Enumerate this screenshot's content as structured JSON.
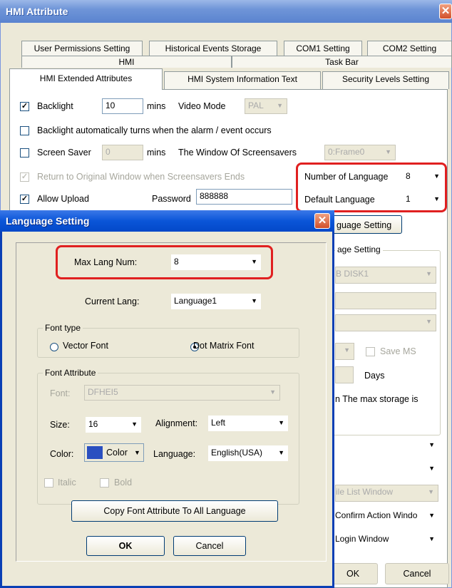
{
  "window": {
    "title": "HMI Attribute",
    "close": "✕"
  },
  "tabs_row1": [
    "User Permissions Setting",
    "Historical Events Storage",
    "COM1 Setting",
    "COM2 Setting"
  ],
  "tabs_row2": [
    "HMI",
    "Task Bar"
  ],
  "tabs_row3": [
    "HMI Extended Attributes",
    "HMI System Information Text",
    "Security Levels Setting"
  ],
  "main": {
    "backlight_label": "Backlight",
    "backlight_value": "10",
    "mins": "mins",
    "video_mode_label": "Video Mode",
    "video_mode_value": "PAL",
    "backlight_alarm_label": "Backlight automatically turns when the alarm / event occurs",
    "screen_saver_label": "Screen Saver",
    "screen_saver_value": "0",
    "mins2": "mins",
    "window_of_screensavers_label": "The Window Of Screensavers",
    "screensaver_window_value": "0:Frame0",
    "return_label": "Return to Original Window when Screensavers Ends",
    "num_language_label": "Number of Language",
    "num_language_value": "8",
    "allow_upload_label": "Allow Upload",
    "password_label": "Password",
    "password_value": "888888",
    "default_language_label": "Default Language",
    "default_language_value": "1",
    "language_setting_button": "guage Setting",
    "storage_group_title": "age Setting",
    "storage_device": "B DISK1",
    "save_ms_label": "Save MS",
    "days_label": "Days",
    "max_storage_text": "n The max storage is",
    "file_list_window": "ile List Window",
    "confirm_action_window": "Confirm Action Windo",
    "login_window": "Login Window",
    "ok": "OK",
    "cancel": "Cancel"
  },
  "dialog": {
    "title": "Language Setting",
    "close": "✕",
    "max_lang_label": "Max Lang Num:",
    "max_lang_value": "8",
    "current_lang_label": "Current Lang:",
    "current_lang_value": "Language1",
    "font_type_title": "Font type",
    "vector_font": "Vector Font",
    "dot_matrix_font": "Dot Matrix Font",
    "font_attribute_title": "Font Attribute",
    "font_label": "Font:",
    "font_value": "DFHEI5",
    "size_label": "Size:",
    "size_value": "16",
    "alignment_label": "Alignment:",
    "alignment_value": "Left",
    "color_label": "Color:",
    "color_button": "Color",
    "color_swatch": "#2a4fc0",
    "language_label": "Language:",
    "language_value": "English(USA)",
    "italic_label": "Italic",
    "bold_label": "Bold",
    "copy_button": "Copy Font Attribute To All Language",
    "ok": "OK",
    "cancel": "Cancel"
  },
  "colors": {
    "highlight": "#e02020",
    "titlebar": "#0a55d8"
  }
}
